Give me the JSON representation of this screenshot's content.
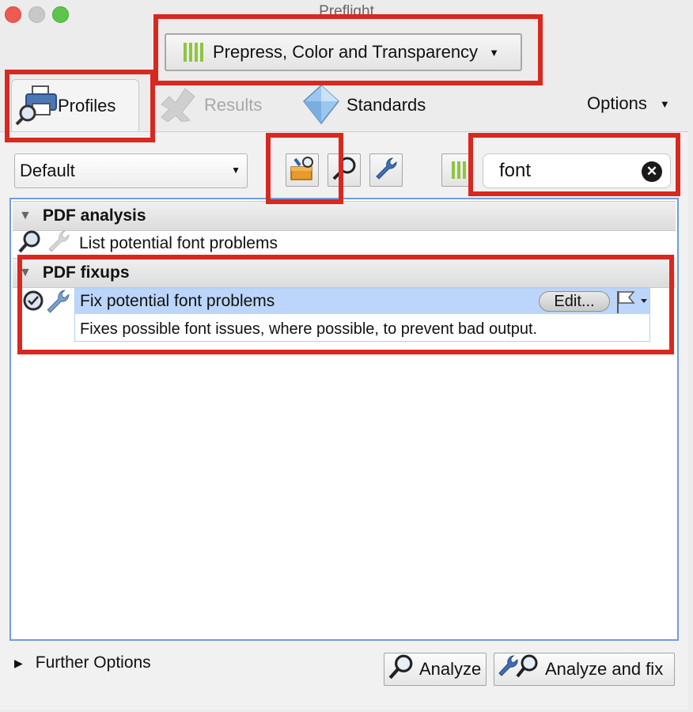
{
  "window": {
    "title": "Preflight"
  },
  "profile_dropdown": {
    "label": "Prepress, Color and Transparency"
  },
  "tabs": [
    {
      "label": "Profiles"
    },
    {
      "label": "Results"
    },
    {
      "label": "Standards"
    }
  ],
  "options_menu": {
    "label": "Options"
  },
  "toolbar": {
    "library_select": "Default",
    "search": {
      "value": "font"
    }
  },
  "groups": [
    {
      "label": "PDF analysis",
      "items": [
        {
          "label": "List potential font problems"
        }
      ]
    },
    {
      "label": "PDF fixups",
      "items": [
        {
          "label": "Fix potential font problems",
          "description": "Fixes possible font issues, where possible, to prevent bad output.",
          "edit_label": "Edit..."
        }
      ]
    }
  ],
  "footer": {
    "further_options": "Further Options",
    "analyze": "Analyze",
    "analyze_fix": "Analyze and fix"
  },
  "colors": {
    "highlight": "#d8281f",
    "selection": "#bcd6fb",
    "accent_green": "#8dc63f"
  }
}
